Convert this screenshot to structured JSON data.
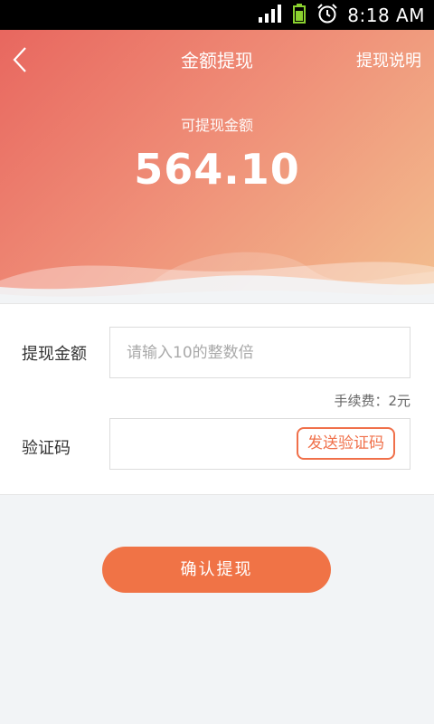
{
  "status_bar": {
    "time": "8:18 AM",
    "icons": [
      "signal-icon",
      "battery-icon",
      "alarm-icon"
    ]
  },
  "header": {
    "title": "金额提现",
    "help_link": "提现说明",
    "back_icon": "chevron-left-icon"
  },
  "balance": {
    "label": "可提现金额",
    "value": "564.10"
  },
  "form": {
    "amount_label": "提现金额",
    "amount_placeholder": "请输入10的整数倍",
    "amount_value": "",
    "fee_text": "手续费：2元",
    "code_label": "验证码",
    "code_value": "",
    "send_code_label": "发送验证码"
  },
  "confirm_label": "确认提现",
  "colors": {
    "accent": "#f07346",
    "gradient_start": "#e8675f",
    "gradient_end": "#f3bf8f",
    "background": "#f2f4f6"
  }
}
